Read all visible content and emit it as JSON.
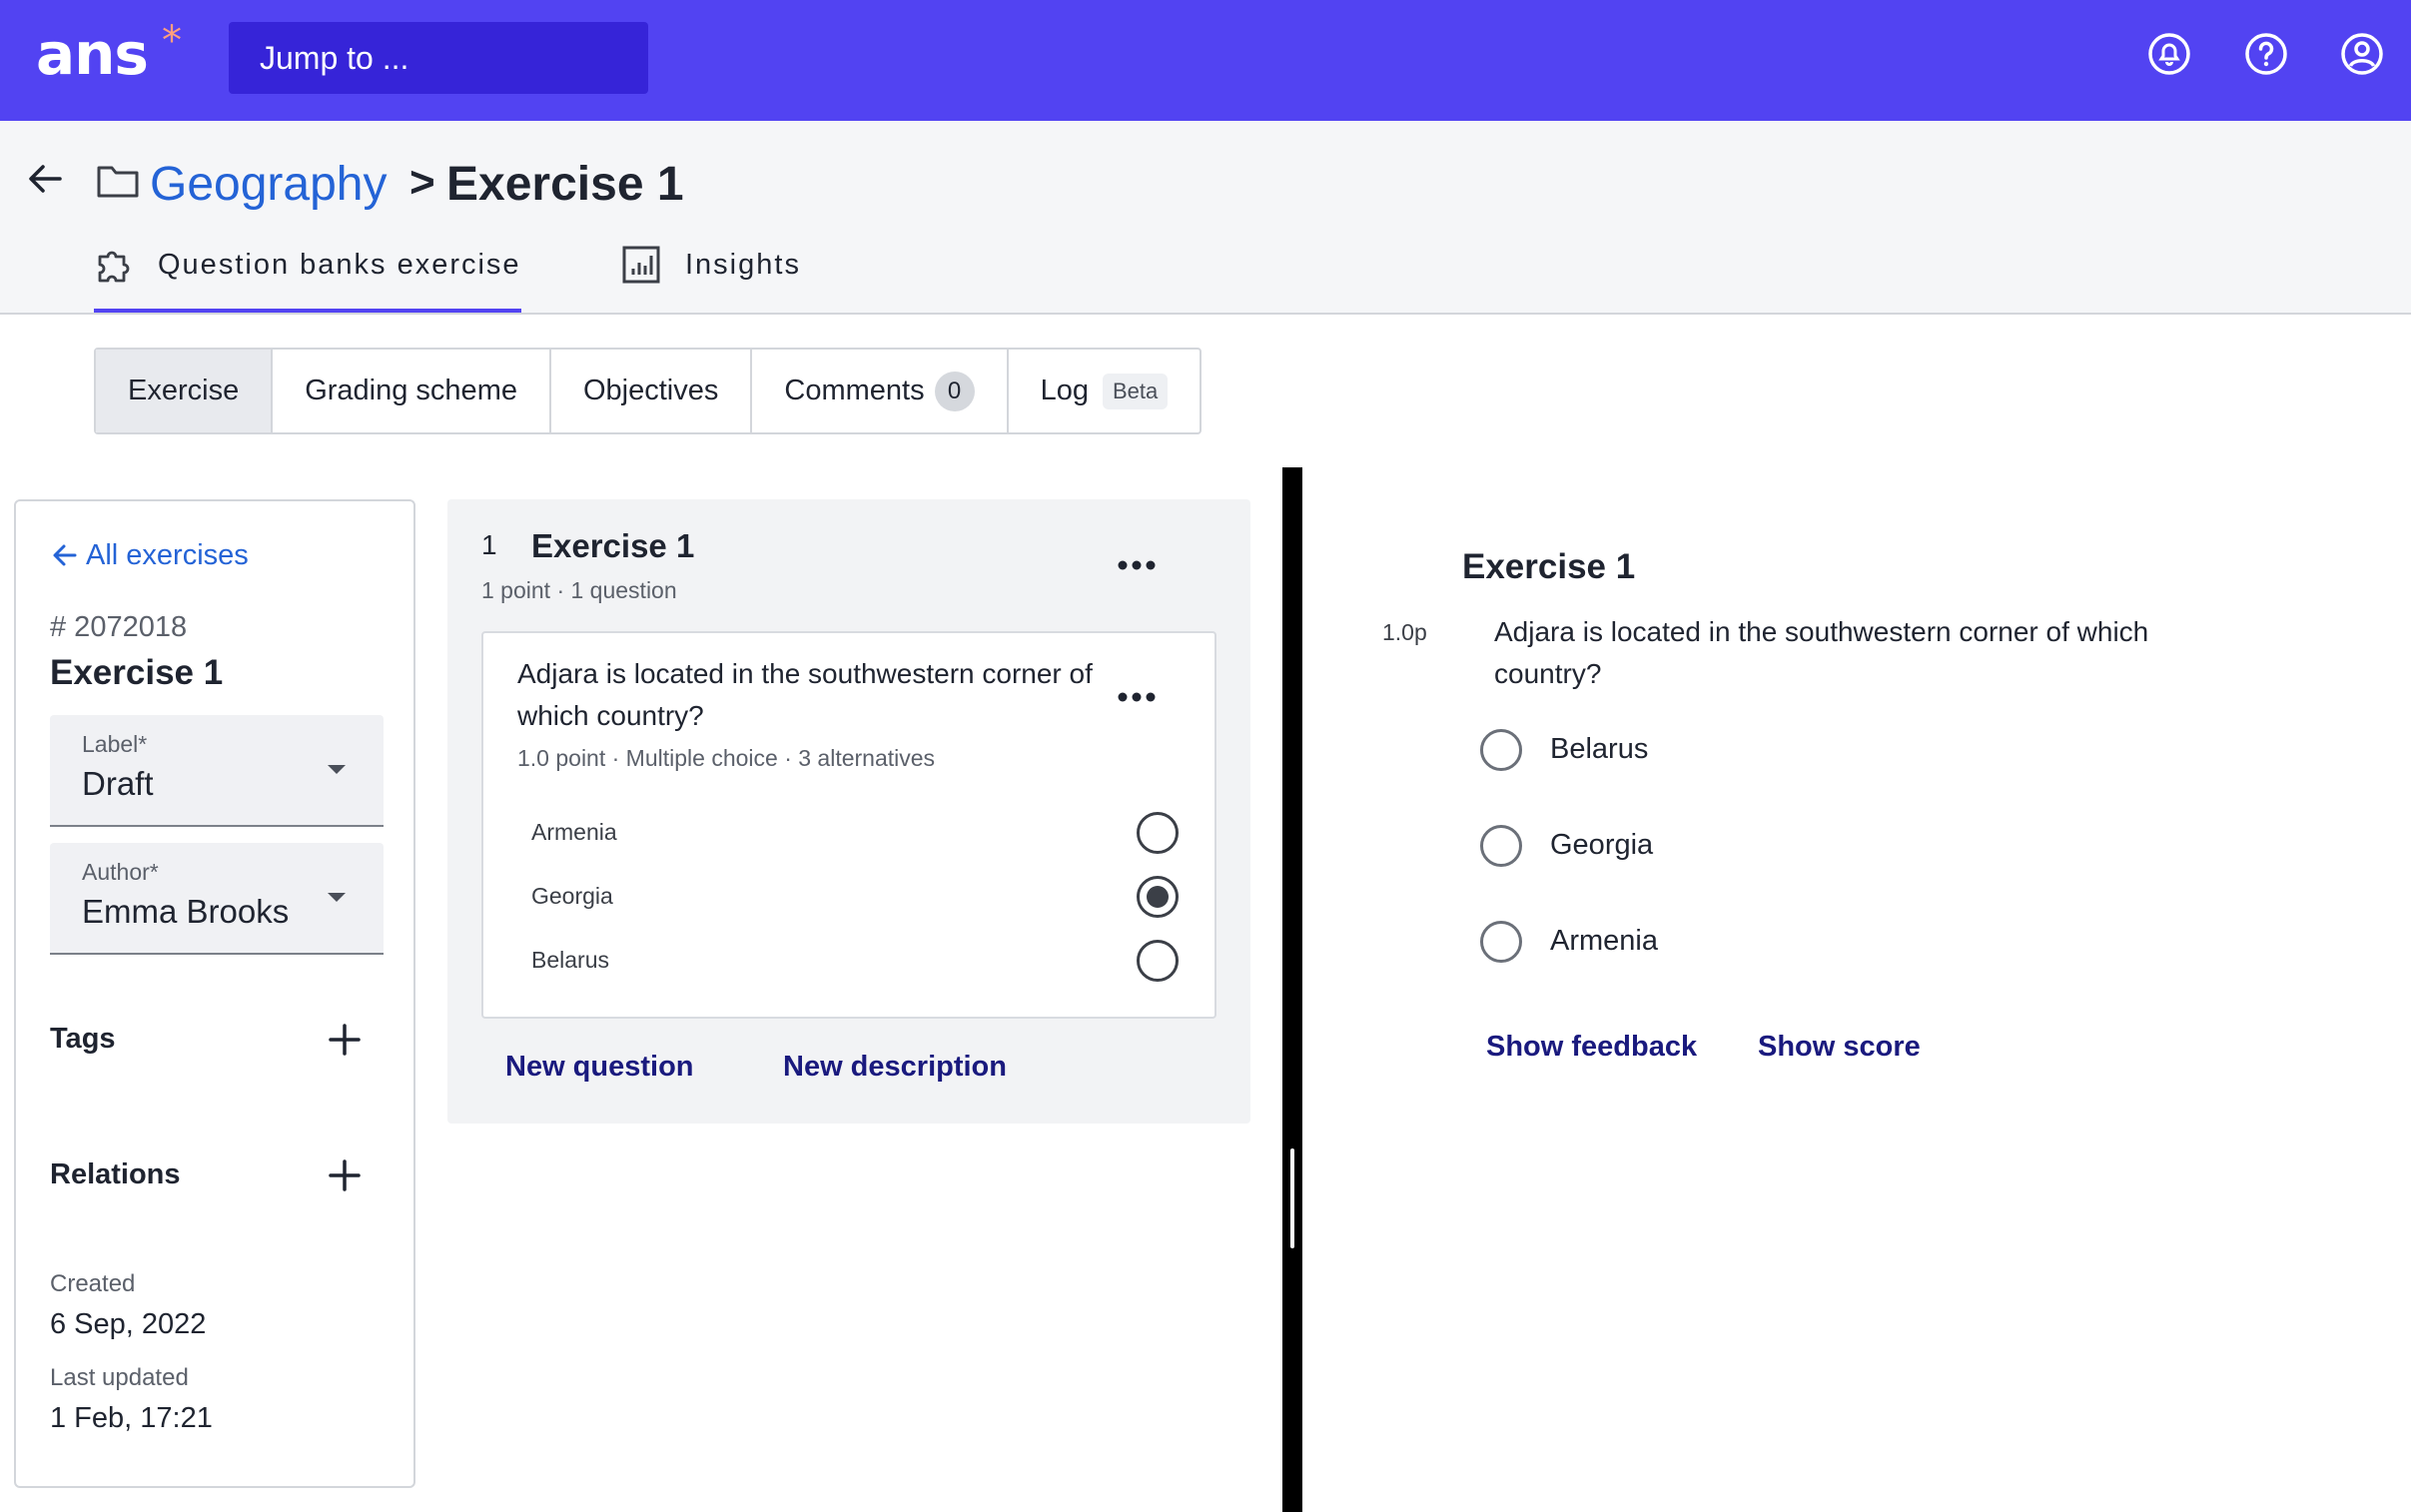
{
  "topbar": {
    "logo": "ans",
    "logo_mark": "*",
    "jump_placeholder": "Jump to ...",
    "icons": [
      "bell-icon",
      "help-icon",
      "account-icon"
    ]
  },
  "breadcrumb": {
    "folder": "Geography",
    "separator": ">",
    "current": "Exercise 1"
  },
  "main_tabs": [
    {
      "label": "Question banks exercise",
      "icon": "puzzle-icon",
      "active": true
    },
    {
      "label": "Insights",
      "icon": "chart-icon",
      "active": false
    }
  ],
  "sub_tabs": {
    "exercise": "Exercise",
    "grading": "Grading scheme",
    "objectives": "Objectives",
    "comments": "Comments",
    "comments_count": "0",
    "log": "Log",
    "log_badge": "Beta"
  },
  "left_panel": {
    "all_exercises": "All exercises",
    "id": "# 2072018",
    "title": "Exercise 1",
    "label_field": {
      "label": "Label*",
      "value": "Draft"
    },
    "author_field": {
      "label": "Author*",
      "value": "Emma Brooks"
    },
    "tags": "Tags",
    "relations": "Relations",
    "created_label": "Created",
    "created_value": "6 Sep, 2022",
    "updated_label": "Last updated",
    "updated_value": "1 Feb, 17:21"
  },
  "editor": {
    "number": "1",
    "title": "Exercise 1",
    "subtitle": "1 point · 1 question",
    "question": {
      "text": "Adjara is located in the southwestern corner of which country?",
      "meta": "1.0 point · Multiple choice · 3 alternatives",
      "options": [
        {
          "label": "Armenia",
          "selected": false
        },
        {
          "label": "Georgia",
          "selected": true
        },
        {
          "label": "Belarus",
          "selected": false
        }
      ]
    },
    "new_question": "New question",
    "new_description": "New description"
  },
  "preview": {
    "title": "Exercise 1",
    "points": "1.0p",
    "question": "Adjara is located in the southwestern corner of which country?",
    "options": [
      "Belarus",
      "Georgia",
      "Armenia"
    ],
    "show_feedback": "Show feedback",
    "show_score": "Show score"
  }
}
